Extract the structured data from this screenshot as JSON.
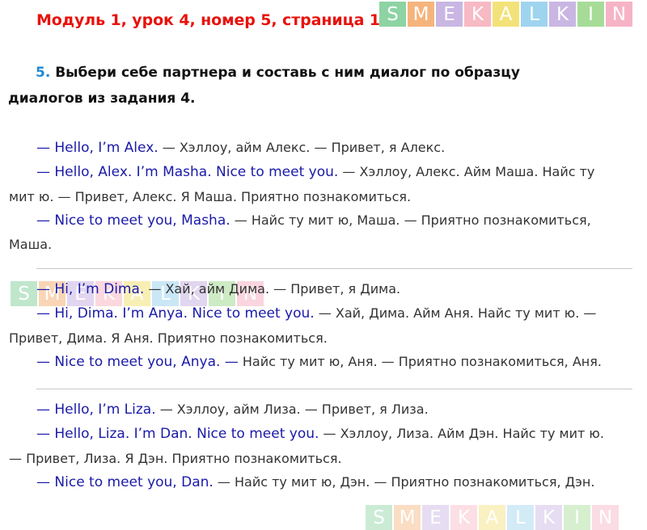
{
  "header": {
    "title": "Модуль 1, урок 4, номер 5, страница 16"
  },
  "logo": {
    "letters": [
      {
        "char": "S",
        "color": "#8dd3a3"
      },
      {
        "char": "M",
        "color": "#f5b47c"
      },
      {
        "char": "E",
        "color": "#c9b6e3"
      },
      {
        "char": "K",
        "color": "#f7b9c4"
      },
      {
        "char": "A",
        "color": "#f3e27a"
      },
      {
        "char": "L",
        "color": "#9fd4ef"
      },
      {
        "char": "K",
        "color": "#c9b6e3"
      },
      {
        "char": "I",
        "color": "#a6dc97"
      },
      {
        "char": "N",
        "color": "#f7b3c6"
      }
    ]
  },
  "task": {
    "number": "5.",
    "text": " Выбери себе партнера и составь с ним диалог по образцу диалогов из задания 4."
  },
  "dialogs": [
    {
      "lines": [
        {
          "en": "— Hello, I’m Alex.",
          "ru": " — Хэллоу, айм Алекс. — Привет, я Алекс."
        },
        {
          "en": "— Hello, Alex. I’m Masha. Nice to meet you.",
          "ru": " — Хэллоу, Алекс. Айм Маша. Найс ту мит ю. — Привет, Алекс. Я Маша. Приятно познакомиться."
        },
        {
          "en": "— Nice to meet you, Masha.",
          "ru": " — Найс ту мит ю, Маша. — Приятно познакомиться, Маша."
        }
      ]
    },
    {
      "lines": [
        {
          "en": "— Hi, I’m Dima.",
          "ru": " — Хай, айм Дима. — Привет, я Дима."
        },
        {
          "en": "— Hi, Dima. I’m Anya. Nice to meet you.",
          "ru": " — Хай, Дима. Айм Аня. Найс ту мит ю. — Привет, Дима. Я Аня. Приятно познакомиться."
        },
        {
          "en": "— Nice to meet you, Anya. —",
          "ru": " Найс ту мит ю, Аня. — Приятно познакомиться, Аня."
        }
      ]
    },
    {
      "lines": [
        {
          "en": "— Hello, I’m Liza.",
          "ru": " — Хэллоу, айм Лиза. — Привет, я Лиза."
        },
        {
          "en": "— Hello, Liza. I’m Dan. Nice to meet you.",
          "ru": " — Хэллоу, Лиза. Айм Дэн. Найс ту мит ю. — Привет, Лиза. Я Дэн. Приятно познакомиться."
        },
        {
          "en": "— Nice to meet you, Dan.",
          "ru": " — Найс ту мит ю, Дэн. — Приятно познакомиться, Дэн."
        }
      ]
    }
  ]
}
